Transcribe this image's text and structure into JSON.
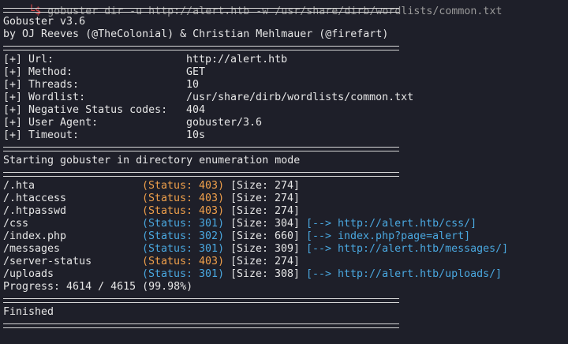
{
  "command_line": {
    "prompt": "└$ ",
    "text": "gobuster dir -u http://alert.htb -w /usr/share/dirb/wordlists/common.txt"
  },
  "banner": {
    "line1": "Gobuster v3.6",
    "line2": "by OJ Reeves (@TheColonial) & Christian Mehlmauer (@firefart)"
  },
  "config": [
    {
      "key": "[+] Url:",
      "value": "http://alert.htb"
    },
    {
      "key": "[+] Method:",
      "value": "GET"
    },
    {
      "key": "[+] Threads:",
      "value": "10"
    },
    {
      "key": "[+] Wordlist:",
      "value": "/usr/share/dirb/wordlists/common.txt"
    },
    {
      "key": "[+] Negative Status codes:",
      "value": "404"
    },
    {
      "key": "[+] User Agent:",
      "value": "gobuster/3.6"
    },
    {
      "key": "[+] Timeout:",
      "value": "10s"
    }
  ],
  "start_message": "Starting gobuster in directory enumeration mode",
  "results": [
    {
      "path": "/.hta",
      "status": "(Status: 403)",
      "size": "[Size: 274]",
      "redirect": ""
    },
    {
      "path": "/.htaccess",
      "status": "(Status: 403)",
      "size": "[Size: 274]",
      "redirect": ""
    },
    {
      "path": "/.htpasswd",
      "status": "(Status: 403)",
      "size": "[Size: 274]",
      "redirect": ""
    },
    {
      "path": "/css",
      "status": "(Status: 301)",
      "size": "[Size: 304]",
      "redirect": "[--> http://alert.htb/css/]"
    },
    {
      "path": "/index.php",
      "status": "(Status: 302)",
      "size": "[Size: 660]",
      "redirect": "[--> index.php?page=alert]"
    },
    {
      "path": "/messages",
      "status": "(Status: 301)",
      "size": "[Size: 309]",
      "redirect": "[--> http://alert.htb/messages/]"
    },
    {
      "path": "/server-status",
      "status": "(Status: 403)",
      "size": "[Size: 274]",
      "redirect": ""
    },
    {
      "path": "/uploads",
      "status": "(Status: 301)",
      "size": "[Size: 308]",
      "redirect": "[--> http://alert.htb/uploads/]"
    }
  ],
  "progress": "Progress: 4614 / 4615 (99.98%)",
  "finished": "Finished",
  "colors": {
    "background": "#1e1f29",
    "text": "#e6e6e6",
    "status_403": "#f0a04b",
    "status_3xx": "#4aa8e0"
  }
}
